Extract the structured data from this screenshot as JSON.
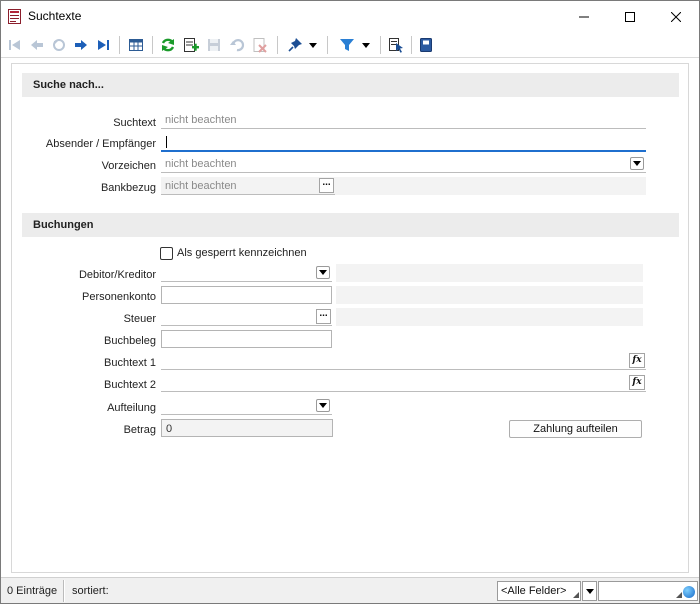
{
  "window": {
    "title": "Suchtexte"
  },
  "icons": {
    "app": "document-list-icon",
    "minimize": "minimize-icon",
    "maximize": "maximize-icon",
    "close": "close-icon",
    "toolbar": [
      "first-record-icon",
      "previous-record-icon",
      "back-icon",
      "next-record-icon",
      "last-record-icon",
      "table-view-icon",
      "refresh-icon",
      "new-record-icon",
      "save-icon",
      "undo-icon",
      "delete-icon",
      "pin-icon",
      "filter-icon",
      "select-icon",
      "book-icon"
    ]
  },
  "colors": {
    "accent_blue": "#1f6fce",
    "refresh_green": "#1a9a2a",
    "section_bg": "#ececec",
    "filter_blue": "#2a7fd4"
  },
  "search_section": {
    "header": "Suche nach...",
    "suchtext": {
      "label": "Suchtext",
      "placeholder": "nicht beachten"
    },
    "absender": {
      "label": "Absender / Empfänger",
      "value": ""
    },
    "vorzeichen": {
      "label": "Vorzeichen",
      "placeholder": "nicht beachten"
    },
    "bankbezug": {
      "label": "Bankbezug",
      "placeholder": "nicht beachten",
      "button": "..."
    }
  },
  "buchungen_section": {
    "header": "Buchungen",
    "gesperrt": {
      "label": "Als gesperrt kennzeichnen",
      "checked": false
    },
    "debitor": {
      "label": "Debitor/Kreditor"
    },
    "personenkonto": {
      "label": "Personenkonto"
    },
    "steuer": {
      "label": "Steuer",
      "button": "..."
    },
    "buchbeleg": {
      "label": "Buchbeleg"
    },
    "buchtext1": {
      "label": "Buchtext 1",
      "button": "fx"
    },
    "buchtext2": {
      "label": "Buchtext 2",
      "button": "fx"
    },
    "aufteilung": {
      "label": "Aufteilung"
    },
    "betrag": {
      "label": "Betrag",
      "value": "0"
    },
    "zahlung_button": "Zahlung aufteilen"
  },
  "statusbar": {
    "count": "0 Einträge",
    "sorted": "sortiert:",
    "field_filter": "<Alle Felder>",
    "search_value": ""
  }
}
